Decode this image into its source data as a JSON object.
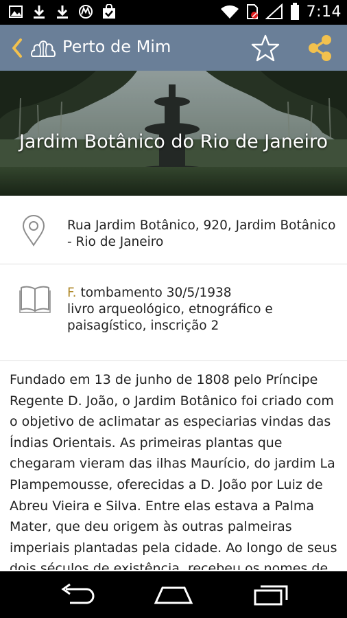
{
  "status_bar": {
    "time": "7:14",
    "left_icons": [
      "image-icon",
      "download-icon",
      "download-icon",
      "motorola-icon",
      "shopping-bag-icon"
    ],
    "right_icons": [
      "wifi-icon",
      "no-sim-icon",
      "signal-icon",
      "battery-icon"
    ]
  },
  "app_bar": {
    "title": "Perto de Mim",
    "color": "#6a7f98"
  },
  "hero": {
    "title": "Jardim Botânico do Rio de Janeiro"
  },
  "address": {
    "icon": "location-pin-icon",
    "text": "Rua Jardim Botânico, 920, Jardim Botânico - Rio de Janeiro"
  },
  "heritage": {
    "icon": "book-icon",
    "prefix": "F.",
    "line1": " tombamento 30/5/1938",
    "line2": "livro arqueológico, etnográfico e paisagístico, inscrição 2",
    "accent_color": "#b08a2c"
  },
  "description": "Fundado em 13 de junho de 1808 pelo Príncipe Regente D. João, o Jardim Botânico foi criado com o objetivo de aclimatar as especiarias vindas das Índias Orientais. As primeiras plantas que chegaram vieram das ilhas Maurício, do jardim La Plampemousse, oferecidas a D. João por Luiz de Abreu Vieira e Silva. Entre elas estava a Palma Mater, que deu origem às outras palmeiras imperiais plantadas pela cidade. Ao longo de seus dois séculos de existência, recebeu os nomes de Real Horto, Real Jardim Botânico, Jardim"
}
